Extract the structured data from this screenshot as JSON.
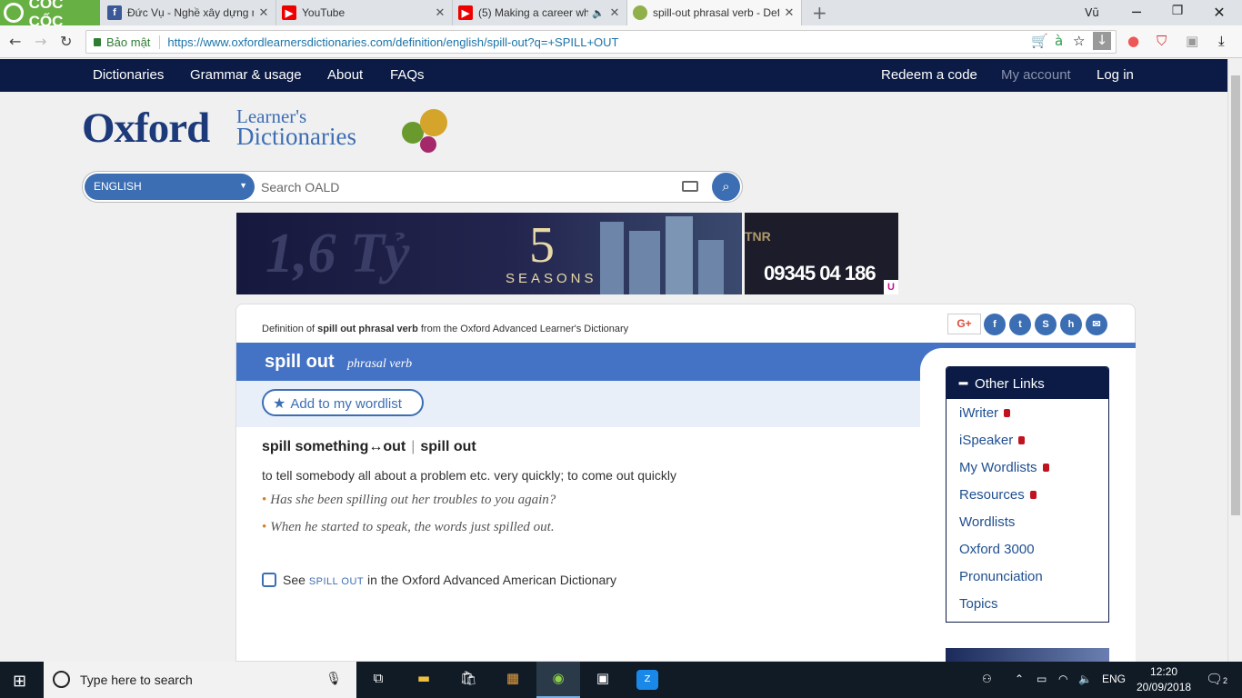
{
  "browser": {
    "brand": "CỐC CỐC",
    "tabs": [
      {
        "title": "Đức Vụ - Nghề xây dựng n",
        "icon": "facebook-icon"
      },
      {
        "title": "YouTube",
        "icon": "youtube-icon"
      },
      {
        "title": "(5) Making a career wh",
        "icon": "youtube-icon"
      },
      {
        "title": "spill-out phrasal verb - Def",
        "icon": "oxford-icon"
      }
    ],
    "secure_label": "Bảo mật",
    "url": "https://www.oxfordlearnersdictionaries.com/definition/english/spill-out?q=+SPILL+OUT",
    "profile": "Vũ"
  },
  "site_nav": {
    "left": [
      "Dictionaries",
      "Grammar & usage",
      "About",
      "FAQs"
    ],
    "right": [
      "Redeem a code",
      "My account",
      "Log in"
    ]
  },
  "logo": {
    "oxford": "Oxford",
    "line1": "Learner's",
    "line2": "Dictionaries"
  },
  "search": {
    "language": "ENGLISH",
    "placeholder": "Search OALD"
  },
  "ad": {
    "big_text": "1,6 Tỷ",
    "number": "5",
    "seasons": "SEASONS",
    "brand": "TNR",
    "phone": "09345 04 186",
    "badge": "U"
  },
  "entry": {
    "definition_of": "Definition of",
    "definition_term": "spill out phrasal verb",
    "definition_source": "from the Oxford Advanced Learner's Dictionary",
    "headword": "spill out",
    "pos": "phrasal verb",
    "wordlist_button": "Add to my wordlist",
    "sense_pattern_a": "spill something↔out",
    "sense_sep": "|",
    "sense_pattern_b": "spill out",
    "definition": "to tell somebody all about a problem etc. very quickly; to come out quickly",
    "examples": [
      "Has she been spilling out her troubles to you again?",
      "When he started to speak, the words just spilled out."
    ],
    "see_also_prefix": "See",
    "see_also_term": "SPILL OUT",
    "see_also_suffix": "in the Oxford Advanced American Dictionary"
  },
  "social": {
    "gplus": "G+",
    "icons": [
      "facebook-icon",
      "twitter-icon",
      "stumbleupon-icon",
      "hi5-icon",
      "email-icon"
    ]
  },
  "other_links": {
    "title": "Other Links",
    "items": [
      {
        "label": "iWriter",
        "locked": true
      },
      {
        "label": "iSpeaker",
        "locked": true
      },
      {
        "label": "My Wordlists",
        "locked": true
      },
      {
        "label": "Resources",
        "locked": true
      },
      {
        "label": "Wordlists",
        "locked": false
      },
      {
        "label": "Oxford 3000",
        "locked": false
      },
      {
        "label": "Pronunciation",
        "locked": false
      },
      {
        "label": "Topics",
        "locked": false
      }
    ]
  },
  "taskbar": {
    "search_placeholder": "Type here to search",
    "lang": "ENG",
    "time": "12:20",
    "date": "20/09/2018",
    "notifications": "2"
  },
  "colors": {
    "nav_bg": "#0b1b46",
    "accent": "#4472c4",
    "link": "#1f4f91",
    "lock": "#c1121f"
  }
}
